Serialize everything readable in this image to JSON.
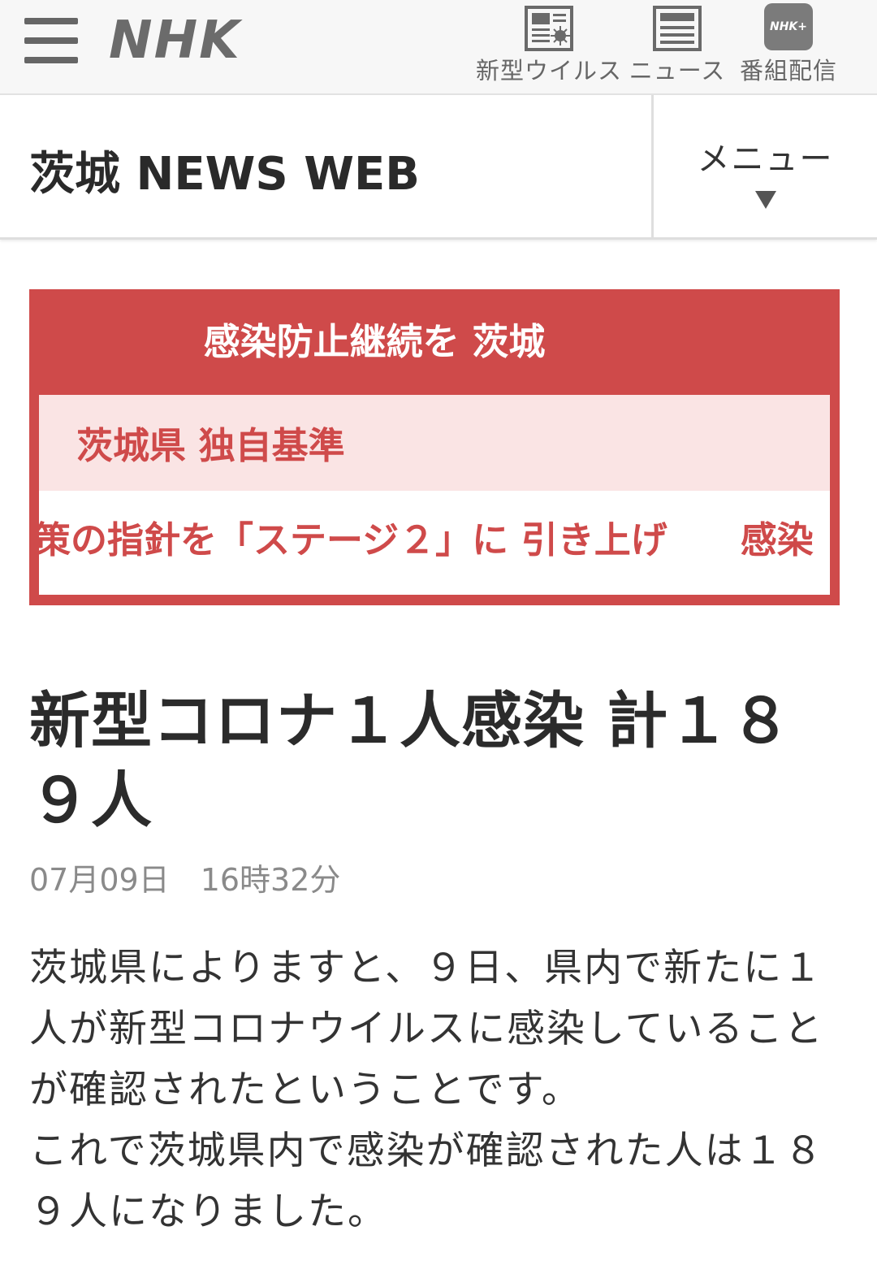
{
  "topbar": {
    "logo": "NHK",
    "nav": [
      {
        "label": "新型ウイルス",
        "icon": "virus-news-icon"
      },
      {
        "label": "ニュース",
        "icon": "newspaper-icon"
      },
      {
        "label": "番組配信",
        "icon": "nhk-plus-icon",
        "icon_text": "NHK+"
      }
    ]
  },
  "header": {
    "title": "茨城 NEWS WEB",
    "menu_label": "メニュー"
  },
  "banner": {
    "title": "感染防止継続を 茨城",
    "subtitle": "茨城県 独自基準",
    "ticker": "策の指針を「ステージ２」に 引き上げ　　感染",
    "colors": {
      "accent": "#cf4a4a",
      "sub_bg": "#fae4e4"
    }
  },
  "article": {
    "headline": "新型コロナ１人感染 計１８９人",
    "datetime": "07月09日　16時32分",
    "paragraphs": [
      "茨城県によりますと、９日、県内で新たに１人が新型コロナウイルスに感染していることが確認されたということです。",
      "これで茨城県内で感染が確認された人は１８９人になりました。"
    ]
  }
}
